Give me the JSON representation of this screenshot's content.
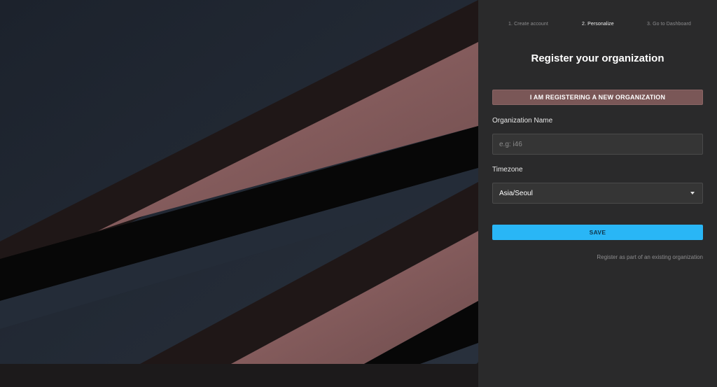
{
  "stepper": {
    "steps": [
      {
        "label": "1. Create account",
        "active": false
      },
      {
        "label": "2. Personalize",
        "active": true
      },
      {
        "label": "3. Go to Dashboard",
        "active": false
      }
    ]
  },
  "form": {
    "title": "Register your organization",
    "new_org_button": "I AM REGISTERING A NEW ORGANIZATION",
    "org_name_label": "Organization Name",
    "org_name_value": "",
    "org_name_placeholder": "e.g: i46",
    "timezone_label": "Timezone",
    "timezone_value": "Asia/Seoul",
    "save_button": "SAVE",
    "existing_org_link": "Register as part of an existing organization"
  },
  "colors": {
    "panel_bg": "#2a2a2b",
    "accent_blue": "#29b6f6",
    "accent_rose": "#7a5757",
    "hero_slate": "#232b36",
    "hero_pink": "#8a5f5f"
  }
}
